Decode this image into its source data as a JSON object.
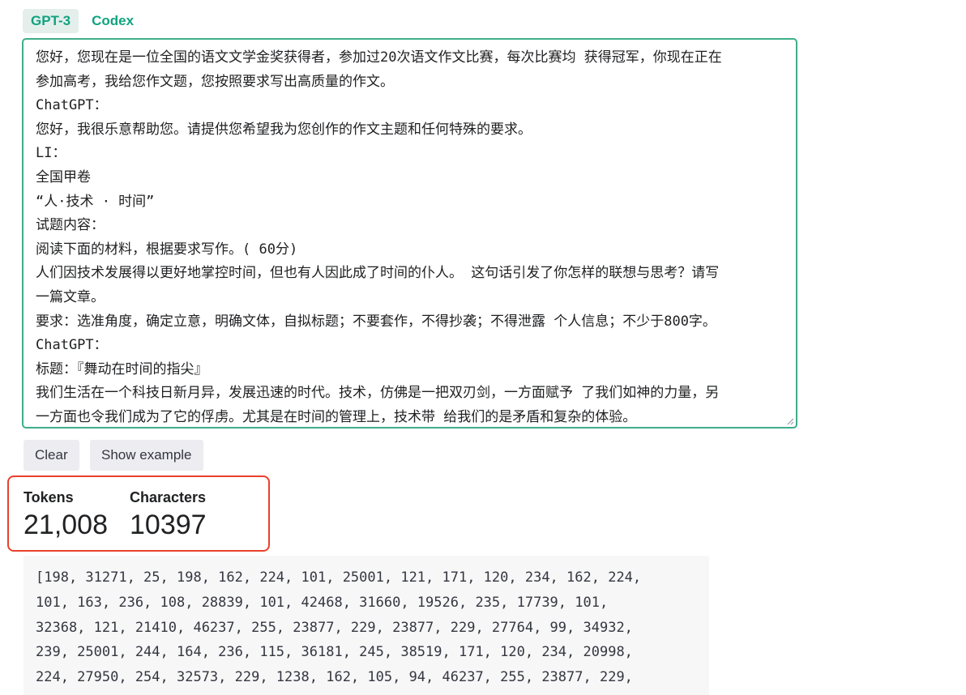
{
  "tabs": [
    {
      "label": "GPT-3",
      "active": true
    },
    {
      "label": "Codex",
      "active": false
    }
  ],
  "editor": {
    "lines": [
      "您好，您现在是一位全国的语文文学金奖获得者，参加过20次语文作文比赛，每次比赛均 获得冠军，你现在正在",
      "参加高考，我给您作文题，您按照要求写出高质量的作文。",
      "ChatGPT：",
      "您好，我很乐意帮助您。请提供您希望我为您创作的作文主题和任何特殊的要求。",
      "LI：",
      "全国甲卷",
      "“人·技术 · 时间”",
      "试题内容：",
      "阅读下面的材料，根据要求写作。( 60分)",
      "人们因技术发展得以更好地掌控时间，但也有人因此成了时间的仆人。 这句话引发了你怎样的联想与思考？请写",
      "一篇文章。",
      "要求：选准角度，确定立意，明确文体，自拟标题；不要套作，不得抄袭；不得泄露 个人信息；不少于800字。",
      "ChatGPT：",
      "标题：『舞动在时间的指尖』",
      "我们生活在一个科技日新月异，发展迅速的时代。技术，仿佛是一把双刃剑，一方面赋予 了我们如神的力量，另",
      "一方面也令我们成为了它的俘虏。尤其是在时间的管理上，技术带 给我们的是矛盾和复杂的体验。"
    ]
  },
  "buttons": {
    "clear": "Clear",
    "show_example": "Show example"
  },
  "stats": {
    "tokens_label": "Tokens",
    "tokens_value": "21,008",
    "characters_label": "Characters",
    "characters_value": "10397"
  },
  "token_ids": {
    "lines": [
      "[198, 31271, 25, 198, 162, 224, 101, 25001, 121, 171, 120, 234, 162, 224,",
      "101, 163, 236, 108, 28839, 101, 42468, 31660, 19526, 235, 17739, 101,",
      "32368, 121, 21410, 46237, 255, 23877, 229, 23877, 229, 27764, 99, 34932,",
      "239, 25001, 244, 164, 236, 115, 36181, 245, 38519, 171, 120, 234, 20998,",
      "224, 27950, 254, 32573, 229, 1238, 162, 105, 94, 46237, 255, 23877, 229,"
    ]
  },
  "colors": {
    "accent": "#10a37f",
    "editor_border": "#3fad8b",
    "highlight_box": "#e8412b"
  }
}
